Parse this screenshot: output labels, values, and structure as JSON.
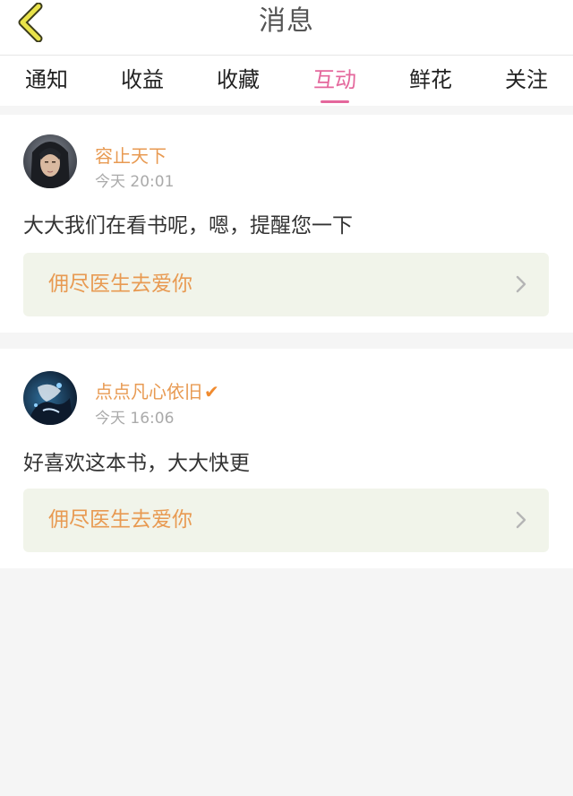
{
  "header": {
    "title": "消息"
  },
  "tabs": [
    {
      "label": "通知"
    },
    {
      "label": "收益"
    },
    {
      "label": "收藏"
    },
    {
      "label": "互动"
    },
    {
      "label": "鲜花"
    },
    {
      "label": "关注"
    }
  ],
  "active_tab": "互动",
  "colors": {
    "accent": "#e4679c",
    "username": "#e89a52",
    "book_card_bg": "#f1f4ea"
  },
  "messages": [
    {
      "username": "容止天下",
      "time": "今天 20:01",
      "content": "大大我们在看书呢，嗯，提醒您一下",
      "book_title": "佣尽医生去爱你"
    },
    {
      "username": "点点凡心依旧",
      "verified": "✔",
      "time": "今天 16:06",
      "content": "好喜欢这本书，大大快更",
      "book_title": "佣尽医生去爱你"
    }
  ]
}
